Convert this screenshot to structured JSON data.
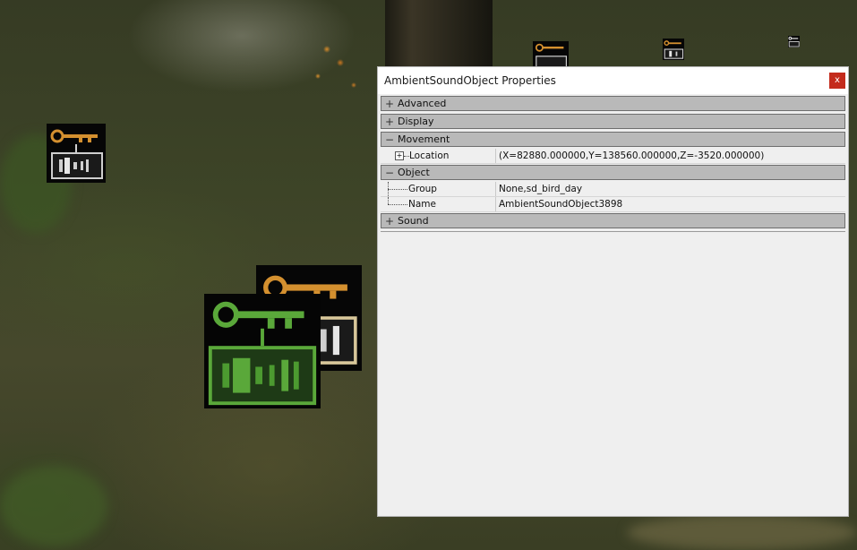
{
  "window": {
    "title": "AmbientSoundObject Properties",
    "close_label": "x"
  },
  "categories": {
    "advanced": {
      "label": "Advanced",
      "state": "collapsed"
    },
    "display": {
      "label": "Display",
      "state": "collapsed"
    },
    "movement": {
      "label": "Movement",
      "state": "expanded"
    },
    "object": {
      "label": "Object",
      "state": "expanded"
    },
    "sound": {
      "label": "Sound",
      "state": "collapsed"
    }
  },
  "properties": {
    "location": {
      "name": "Location",
      "value": "(X=82880.000000,Y=138560.000000,Z=-3520.000000)"
    },
    "group": {
      "name": "Group",
      "value": "None,sd_bird_day"
    },
    "name": {
      "name": "Name",
      "value": "AmbientSoundObject3898"
    }
  },
  "icons": [
    "ambient-sound-actor-icon",
    "key-icon",
    "speaker-icon"
  ],
  "colors": {
    "icon_orange": "#d4902f",
    "icon_selected_green": "#5aa83a",
    "close_red": "#c42b1c",
    "category_bg": "#b9b9b9"
  }
}
